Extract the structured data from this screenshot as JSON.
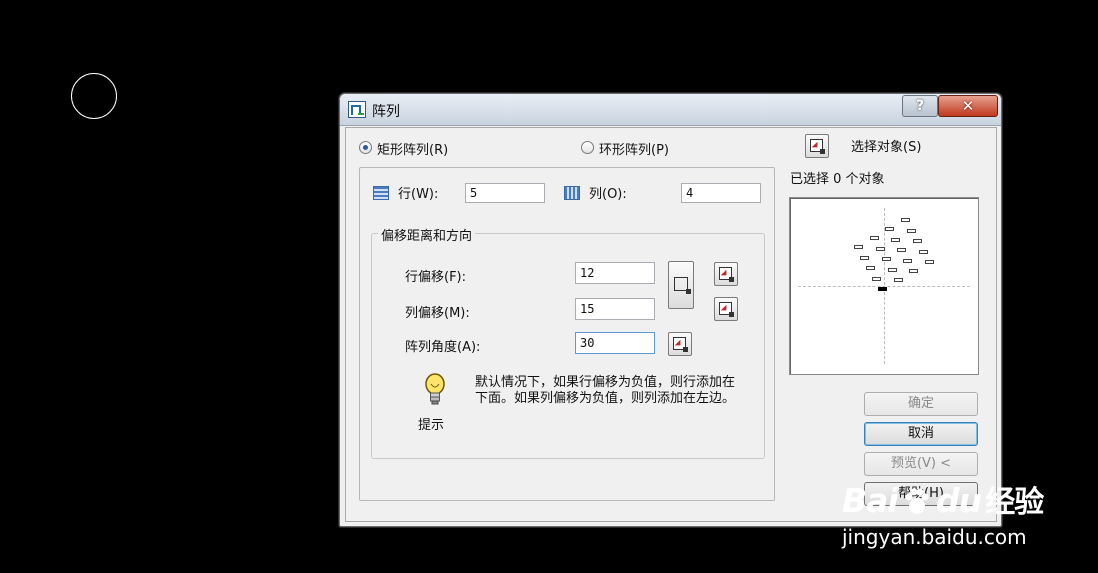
{
  "dialog": {
    "title": "阵列",
    "help_label": "?",
    "close_label": "✕"
  },
  "mode": {
    "rect_label": "矩形阵列(R)",
    "polar_label": "环形阵列(P)",
    "selected": "rect"
  },
  "grid": {
    "rows_label": "行(W):",
    "rows_value": "5",
    "cols_label": "列(O):",
    "cols_value": "4"
  },
  "offset": {
    "group_title": "偏移距离和方向",
    "row_offset_label": "行偏移(F):",
    "row_offset_value": "12",
    "col_offset_label": "列偏移(M):",
    "col_offset_value": "15",
    "angle_label": "阵列角度(A):",
    "angle_value": "30"
  },
  "tip": {
    "label": "提示",
    "text": "默认情况下，如果行偏移为负值，则行添加在下面。如果列偏移为负值，则列添加在左边。"
  },
  "selection": {
    "select_label": "选择对象(S)",
    "count_text": "已选择 0 个对象"
  },
  "buttons": {
    "ok": "确定",
    "cancel": "取消",
    "preview": "预览(V) <",
    "help": "帮助(H)"
  },
  "watermark": {
    "logo_left": "Bai",
    "logo_right": "du",
    "logo_cn": "经验",
    "url": "jingyan.baidu.com"
  }
}
